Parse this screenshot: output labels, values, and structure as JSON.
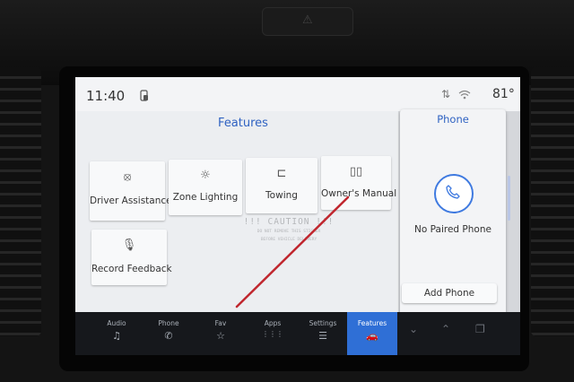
{
  "status": {
    "time": "11:40",
    "temperature": "81°"
  },
  "features": {
    "title": "Features",
    "tiles": [
      {
        "label": "Driver Assistance",
        "icon": "driver-assist-icon"
      },
      {
        "label": "Zone Lighting",
        "icon": "zone-lighting-icon"
      },
      {
        "label": "Towing",
        "icon": "towing-icon"
      },
      {
        "label": "Owner's Manual",
        "icon": "book-icon"
      },
      {
        "label": "Record Feedback",
        "icon": "microphone-icon"
      }
    ],
    "sticker": {
      "title": "!!! CAUTION !!!",
      "line1": "DO NOT REMOVE THIS STICKER",
      "line2": "BEFORE VEHICLE DELIVERY"
    }
  },
  "phone": {
    "title": "Phone",
    "status": "No Paired Phone",
    "add_label": "Add Phone"
  },
  "dock": {
    "items": [
      {
        "label": "Audio",
        "glyph": "♫"
      },
      {
        "label": "Phone",
        "glyph": "✆"
      },
      {
        "label": "Fav",
        "glyph": "☆"
      },
      {
        "label": "Apps",
        "glyph": "⋮⋮⋮"
      },
      {
        "label": "Settings",
        "glyph": "☰"
      },
      {
        "label": "Features",
        "glyph": "🚗"
      }
    ],
    "active": "Features"
  },
  "colors": {
    "accent": "#2f62c2",
    "active_tab": "#2f6fd6",
    "slash": "#c0262e"
  }
}
